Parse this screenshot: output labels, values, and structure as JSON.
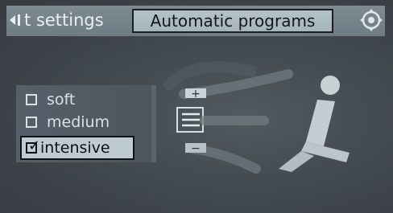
{
  "header": {
    "prev_tab_label": "t settings",
    "active_tab_label": "Automatic programs",
    "control_icon": "controller-knob-icon"
  },
  "program_options": [
    {
      "label": "soft",
      "checked": false
    },
    {
      "label": "medium",
      "checked": false
    },
    {
      "label": "intensive",
      "checked": true
    }
  ],
  "illustration": {
    "plus_symbol": "+",
    "minus_symbol": "−",
    "icon": "seat-massage-icon"
  }
}
